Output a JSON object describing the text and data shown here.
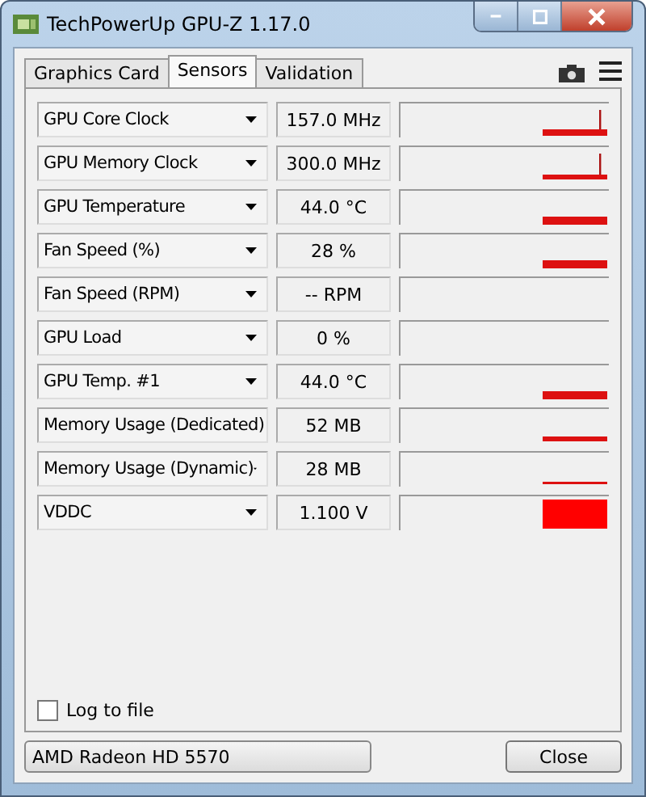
{
  "window": {
    "title": "TechPowerUp GPU-Z 1.17.0"
  },
  "tabs": [
    {
      "label": "Graphics Card",
      "selected": false
    },
    {
      "label": "Sensors",
      "selected": true
    },
    {
      "label": "Validation",
      "selected": false
    }
  ],
  "sensors": [
    {
      "name": "GPU Core Clock",
      "value": "157.0 MHz",
      "kind": "spike"
    },
    {
      "name": "GPU Memory Clock",
      "value": "300.0 MHz",
      "kind": "spike-thin"
    },
    {
      "name": "GPU Temperature",
      "value": "44.0 °C",
      "kind": "thick"
    },
    {
      "name": "Fan Speed (%)",
      "value": "28 %",
      "kind": "thick"
    },
    {
      "name": "Fan Speed (RPM)",
      "value": "-- RPM",
      "kind": "none"
    },
    {
      "name": "GPU Load",
      "value": "0 %",
      "kind": "none"
    },
    {
      "name": "GPU Temp. #1",
      "value": "44.0 °C",
      "kind": "thick"
    },
    {
      "name": "Memory Usage (Dedicated)",
      "value": "52 MB",
      "kind": "medium"
    },
    {
      "name": "Memory Usage (Dynamic)",
      "value": "28 MB",
      "kind": "thin"
    },
    {
      "name": "VDDC",
      "value": "1.100 V",
      "kind": "block"
    }
  ],
  "log_to_file": {
    "label": "Log to file",
    "checked": false
  },
  "device": "AMD Radeon HD 5570",
  "close_button": "Close"
}
